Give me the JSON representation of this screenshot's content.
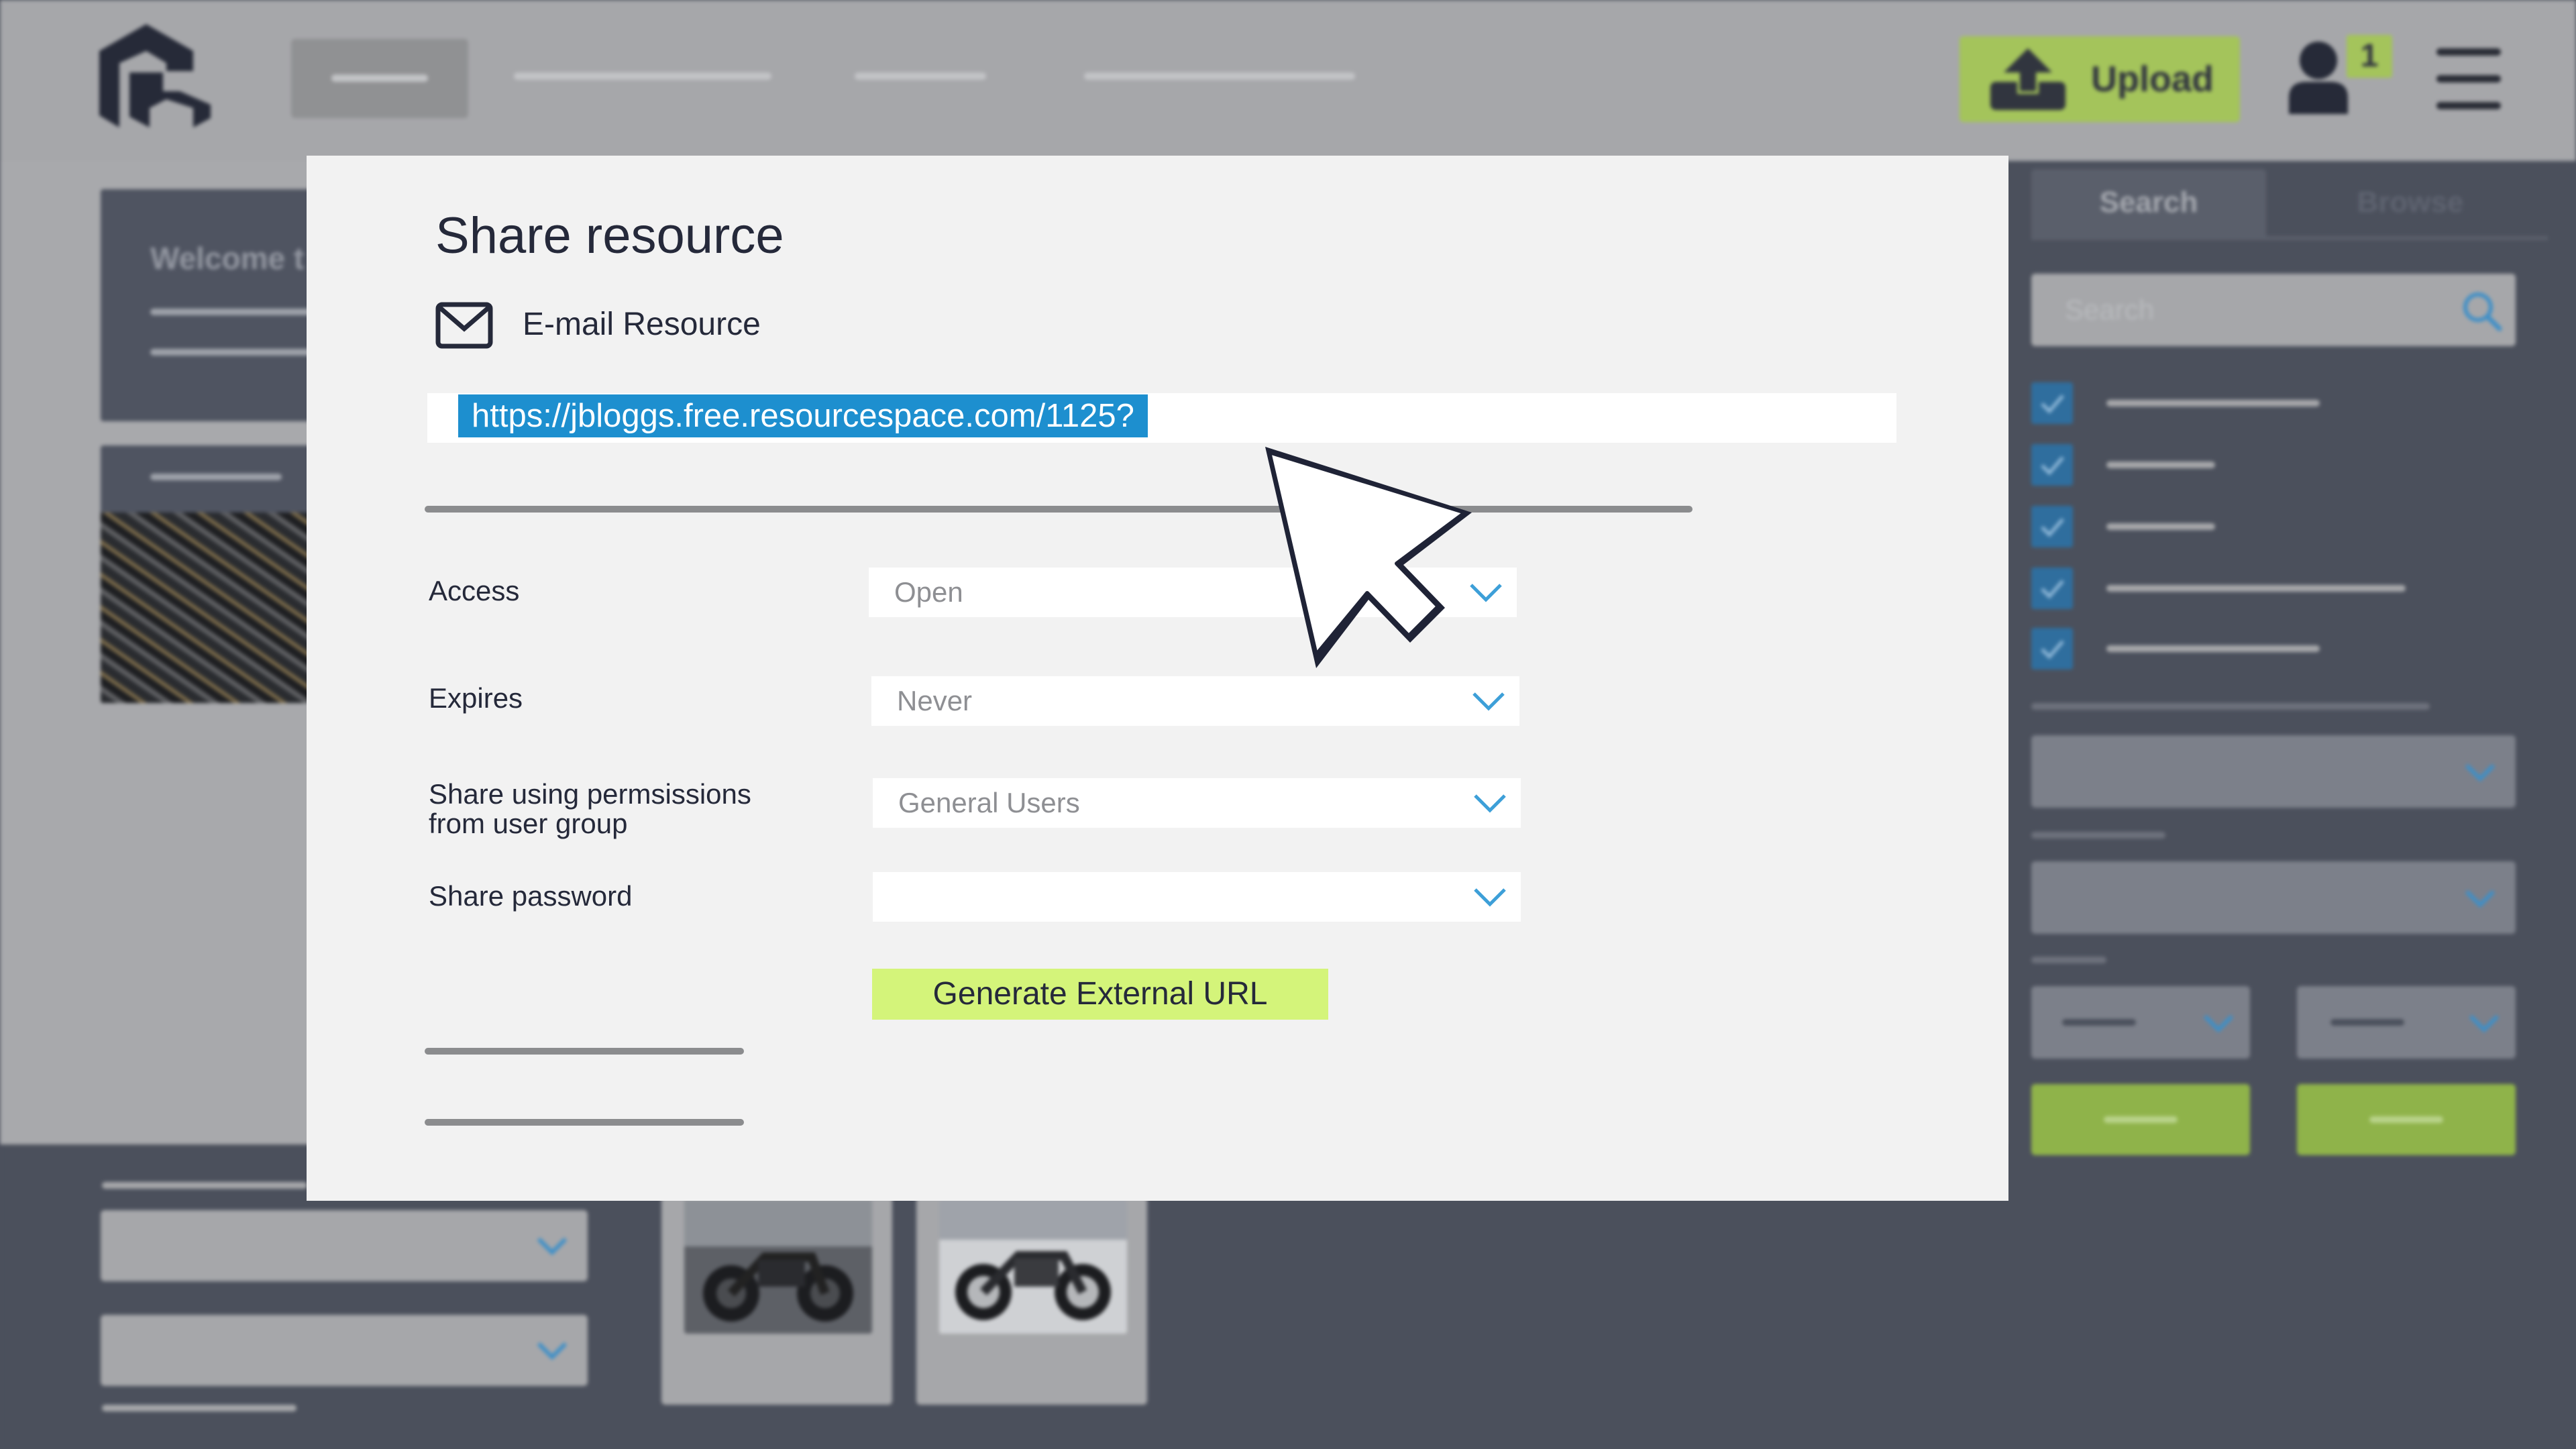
{
  "header": {
    "upload_label": "Upload",
    "notification_count": "1",
    "icons": [
      "logo",
      "upload-icon",
      "user-icon",
      "menu-icon"
    ]
  },
  "background": {
    "welcome_text": "Welcome t",
    "search_tab": "Search",
    "browse_tab": "Browse",
    "search_placeholder": "Search",
    "checked_filters": 5
  },
  "modal": {
    "title": "Share resource",
    "email_label": "E-mail Resource",
    "share_url": "https://jbloggs.free.resourcespace.com/1125?",
    "fields": [
      {
        "label": "Access",
        "value": "Open"
      },
      {
        "label": "Expires",
        "value": "Never"
      },
      {
        "label_line1": "Share using permsissions",
        "label_line2": "from user group",
        "value": "General Users"
      },
      {
        "label": "Share password",
        "value": ""
      }
    ],
    "generate_button": "Generate External URL"
  },
  "colors": {
    "accent_green": "#d4f47a",
    "url_highlight": "#1d8fcf",
    "chevron_blue": "#3d9fd8",
    "dark_navy": "#25293a"
  }
}
